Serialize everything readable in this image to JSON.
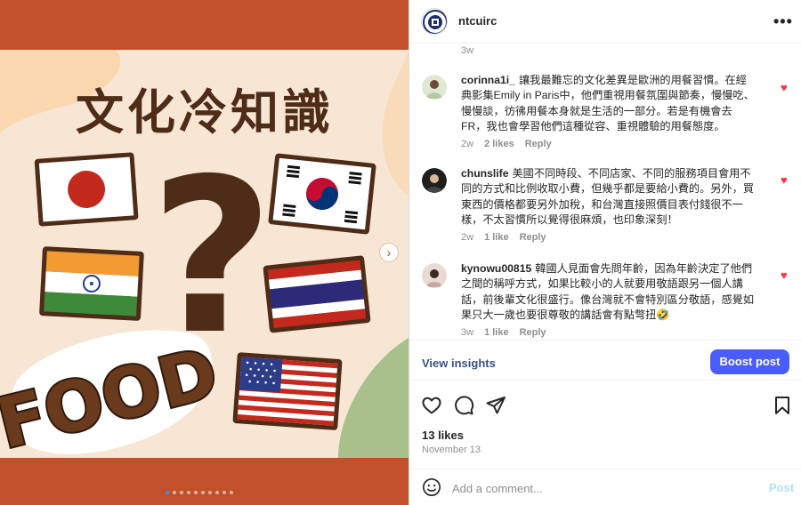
{
  "post_image": {
    "title": "文化冷知識",
    "food_text": "FOOD",
    "question_mark": "?",
    "carousel": {
      "count": 10,
      "active": 0
    }
  },
  "header": {
    "username": "ntcuirc",
    "more_icon": "more-horizontal-icon"
  },
  "top_age": "3w",
  "comments": [
    {
      "username": "corinna1i_",
      "text": "讓我最難忘的文化差異是歐洲的用餐習慣。在經典影集Emily in Paris中，他們重視用餐氛圍與節奏，慢慢吃、慢慢談，彷彿用餐本身就是生活的一部分。若是有機會去FR，我也會學習他們這種從容、重視體驗的用餐態度。",
      "age": "2w",
      "likes": "2 likes",
      "reply": "Reply"
    },
    {
      "username": "chunslife",
      "text": "美國不同時段、不同店家、不同的服務項目會用不同的方式和比例收取小費，但幾乎都是要給小費的。另外，買東西的價格都要另外加稅，和台灣直接照價目表付錢很不一樣，不太習慣所以覺得很麻煩，也印象深刻！",
      "age": "2w",
      "likes": "1 like",
      "reply": "Reply"
    },
    {
      "username": "kynowu00815",
      "text": "韓國人見面會先問年齡，因為年齡決定了他們之間的稱呼方式，如果比較小的人就要用敬語跟另一個人講話，前後輩文化很盛行。像台灣就不會特別區分敬語，感覺如果只大一歲也要很尊敬的講話會有點彆扭🤣",
      "age": "3w",
      "likes": "1 like",
      "reply": "Reply"
    }
  ],
  "insights": {
    "view_label": "View insights",
    "boost_label": "Boost post"
  },
  "actions": {
    "like_icon": "heart-outline-icon",
    "comment_icon": "comment-icon",
    "share_icon": "send-icon",
    "save_icon": "bookmark-icon"
  },
  "likes_count": "13 likes",
  "post_date": "November 13",
  "comment_box": {
    "placeholder": "Add a comment...",
    "post_label": "Post"
  },
  "colors": {
    "brand_rust": "#c2502a",
    "title_brown": "#4e2c18",
    "boost_blue": "#4a5df9",
    "insights_link": "#385185",
    "heart_red": "#ff3040"
  }
}
